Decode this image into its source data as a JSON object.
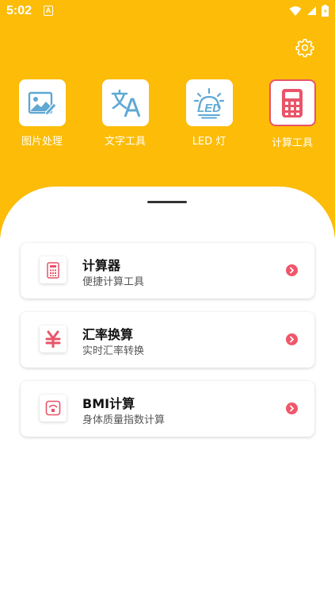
{
  "status_bar": {
    "time": "5:02",
    "app_icon_letter": "A",
    "icons": [
      "wifi-icon",
      "signal-icon",
      "battery-icon"
    ]
  },
  "colors": {
    "header": "#FCBC07",
    "accent": "#F0566A",
    "icon_blue": "#5FA8D3",
    "icon_red": "#E95468"
  },
  "header": {
    "settings_icon": "gear-icon"
  },
  "tools": [
    {
      "label": "图片处理",
      "icon": "image-edit-icon",
      "active": false
    },
    {
      "label": "文字工具",
      "icon": "translate-icon",
      "active": false
    },
    {
      "label": "LED 灯",
      "icon": "led-icon",
      "active": false
    },
    {
      "label": "计算工具",
      "icon": "calculator-icon",
      "active": true
    }
  ],
  "cards": [
    {
      "title": "计算器",
      "subtitle": "便捷计算工具",
      "icon": "calculator-icon"
    },
    {
      "title": "汇率换算",
      "subtitle": "实时汇率转换",
      "icon": "yen-icon"
    },
    {
      "title": "BMI计算",
      "subtitle": "身体质量指数计算",
      "icon": "scale-icon"
    }
  ]
}
